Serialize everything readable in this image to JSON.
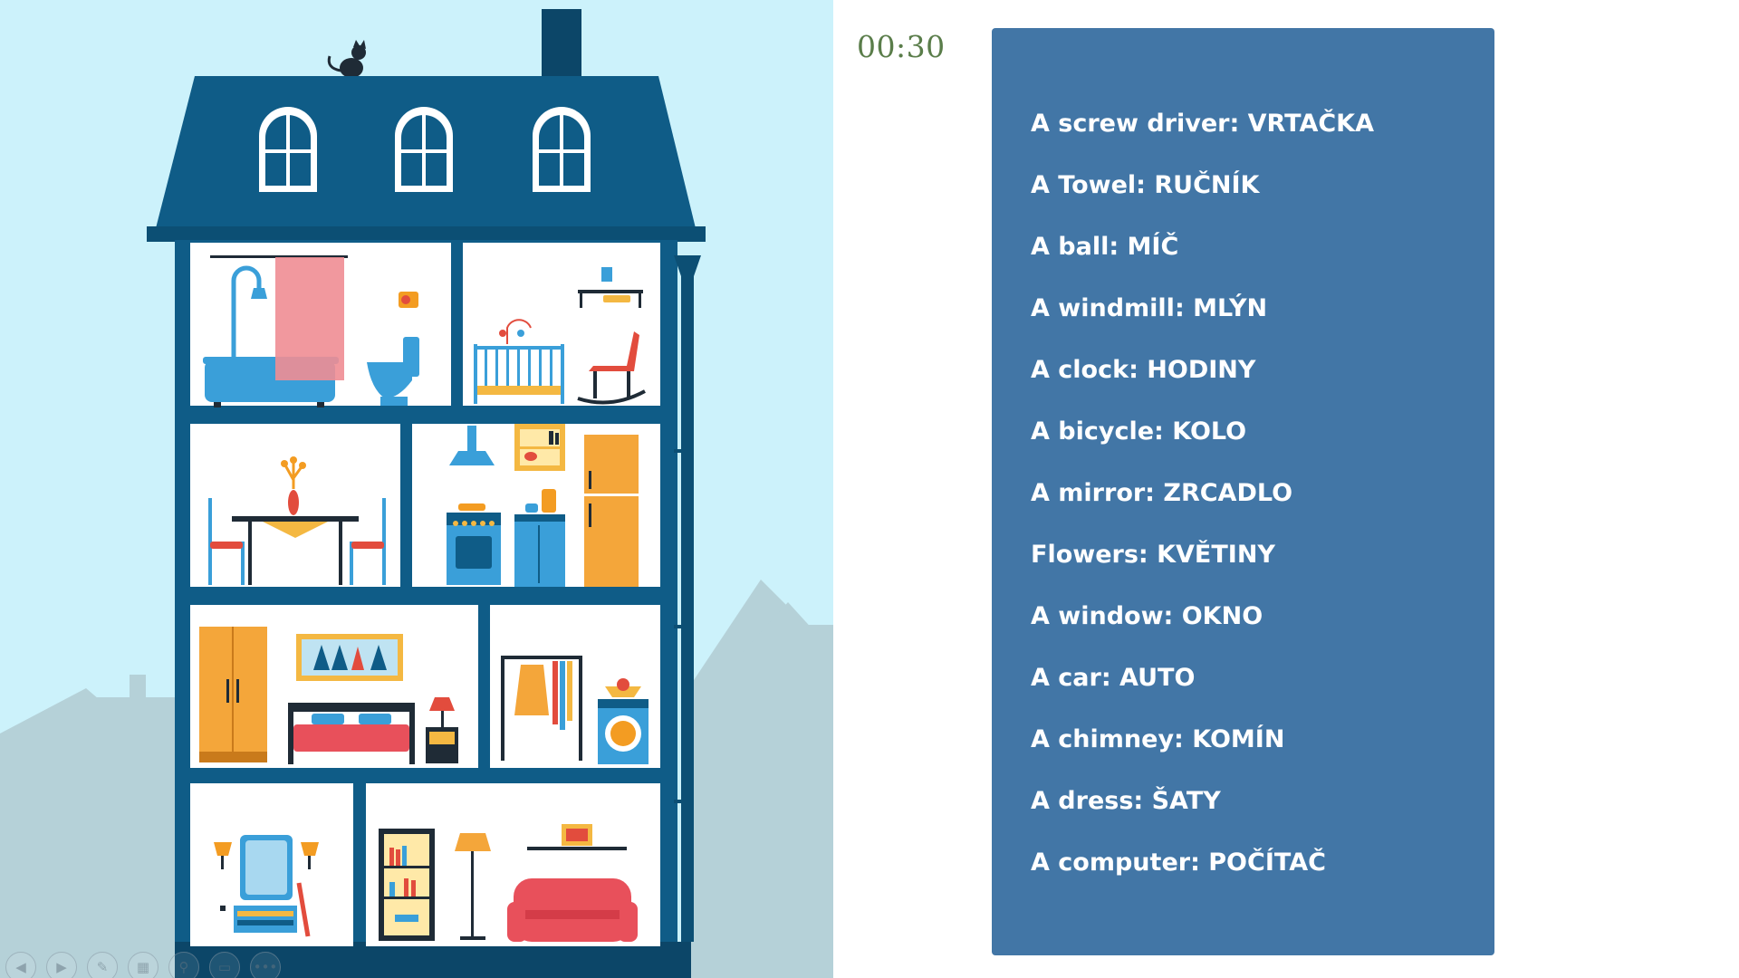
{
  "timer": "00:30",
  "vocabulary": [
    "A screw driver: VRTAČKA",
    "A Towel: RUČNÍK",
    "A ball: MÍČ",
    "A windmill: MLÝN",
    "A clock: HODINY",
    "A bicycle: KOLO",
    "A mirror: ZRCADLO",
    "Flowers: KVĚTINY",
    "A window: OKNO",
    "A car: AUTO",
    "A chimney: KOMÍN",
    "A dress: ŠATY",
    "A computer: POČÍTAČ"
  ],
  "toolbar": {
    "buttons": [
      {
        "name": "previous-slide-button",
        "glyph": "◀"
      },
      {
        "name": "next-slide-button",
        "glyph": "▶"
      },
      {
        "name": "pen-tool-button",
        "glyph": "✎"
      },
      {
        "name": "see-all-slides-button",
        "glyph": "▦"
      },
      {
        "name": "zoom-button",
        "glyph": "⚲"
      },
      {
        "name": "subtitles-button",
        "glyph": "▭"
      },
      {
        "name": "more-options-button",
        "glyph": "•••"
      }
    ]
  },
  "colors": {
    "sky": "#ccf2fb",
    "house_navy": "#0f5c87",
    "panel_blue": "#4276a6",
    "timer_green": "#5a7d4a",
    "city_silhouette": "#b5d1d8"
  }
}
